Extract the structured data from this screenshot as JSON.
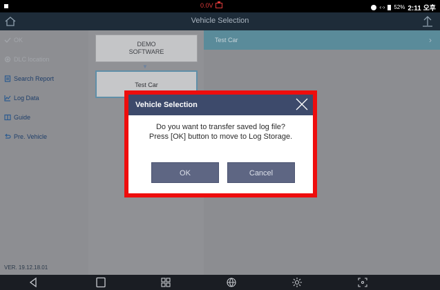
{
  "status_bar": {
    "voltage": "0.0V",
    "battery_percent": "52%",
    "time": "2:11 오후",
    "icons": [
      "notification-dot-icon",
      "battery-red-icon",
      "sync-icon",
      "signal-icon",
      "battery-icon"
    ]
  },
  "title_bar": {
    "title": "Vehicle Selection",
    "home_icon": "home-icon",
    "up_icon": "up-arrow-icon"
  },
  "sidebar": {
    "items": [
      {
        "label": "OK",
        "icon": "check-icon",
        "enabled": false
      },
      {
        "label": "DLC location",
        "icon": "location-icon",
        "enabled": false
      },
      {
        "label": "Search Report",
        "icon": "report-icon",
        "enabled": true
      },
      {
        "label": "Log Data",
        "icon": "chart-icon",
        "enabled": true
      },
      {
        "label": "Guide",
        "icon": "book-icon",
        "enabled": true
      },
      {
        "label": "Pre. Vehicle",
        "icon": "back-arrow-icon",
        "enabled": true
      }
    ],
    "version": "VER. 19.12.18.01"
  },
  "center": {
    "demo_line1": "DEMO",
    "demo_line2": "SOFTWARE",
    "test_car": "Test Car"
  },
  "right": {
    "selected_item": "Test Car"
  },
  "dialog": {
    "title": "Vehicle Selection",
    "message_line1": "Do you want to transfer saved log file?",
    "message_line2": "Press [OK] button to move to Log Storage.",
    "ok_label": "OK",
    "cancel_label": "Cancel"
  },
  "nav_bar": {
    "icons": [
      "back-icon",
      "recent-apps-icon",
      "app-grid-icon",
      "browser-icon",
      "settings-icon",
      "capture-icon"
    ]
  },
  "colors": {
    "highlight_border": "#ee0d0d",
    "dialog_header": "#3d4a6b",
    "button": "#5e6683",
    "selected_row": "#5a8b9a"
  }
}
